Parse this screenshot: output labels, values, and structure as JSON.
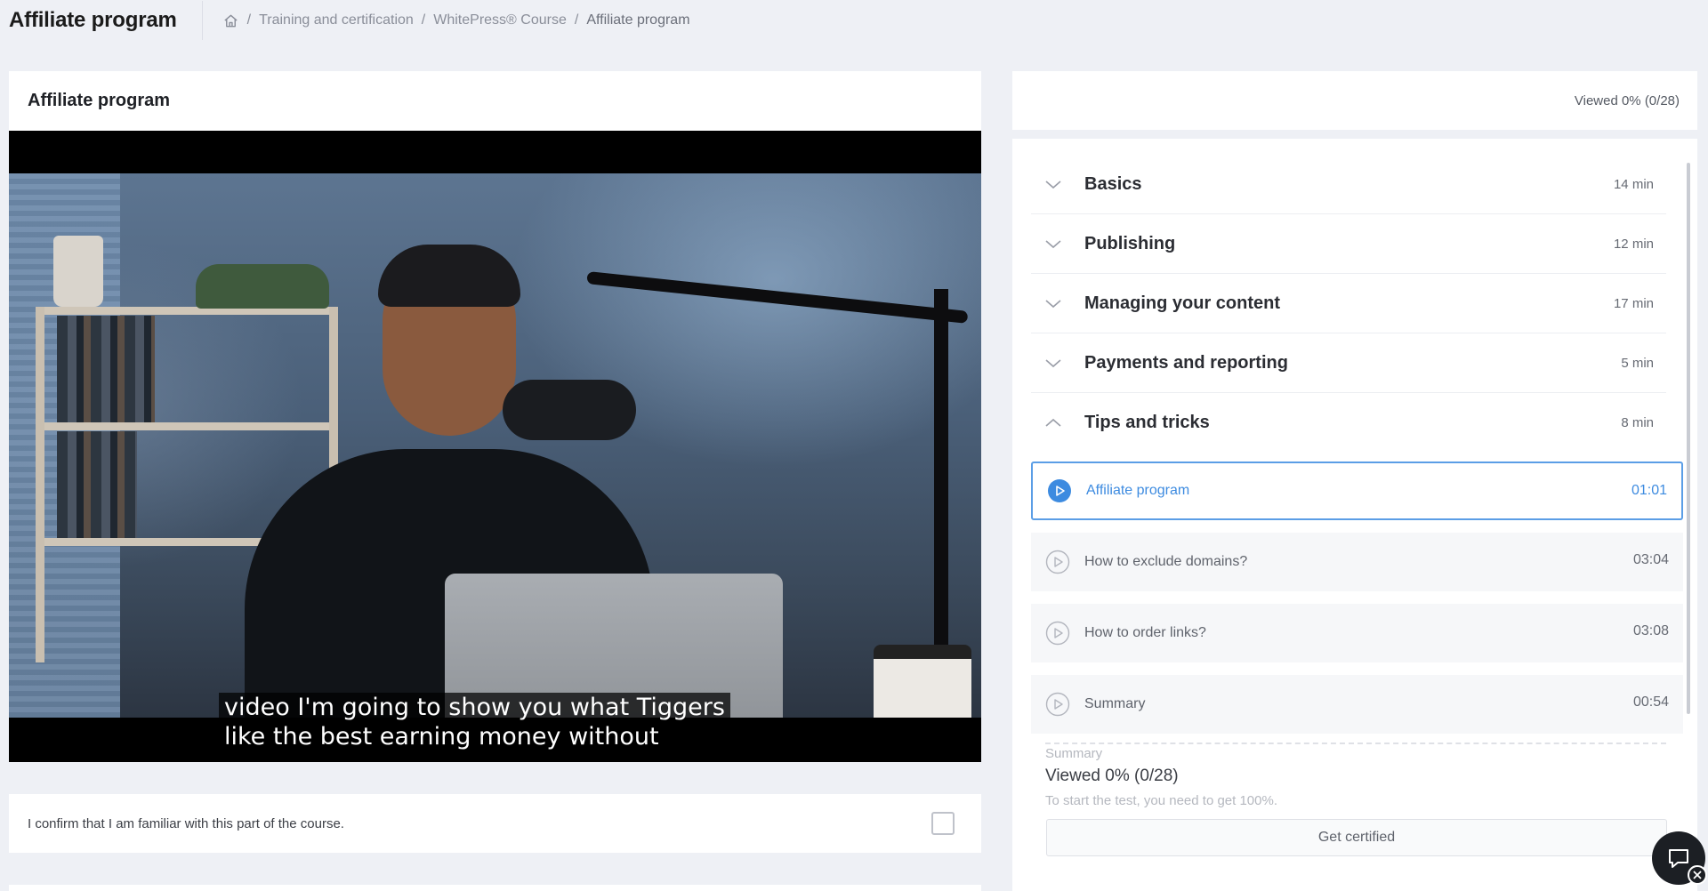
{
  "header": {
    "title": "Affiliate program",
    "breadcrumb": [
      "Training and certification",
      "WhitePress® Course",
      "Affiliate program"
    ]
  },
  "video": {
    "title": "Affiliate program",
    "subtitle_lines": [
      "video I'm going to show you what Tiggers",
      "like the best earning money without"
    ]
  },
  "confirm": {
    "text": "I confirm that I am familiar with this part of the course.",
    "checked": false
  },
  "progress": {
    "label": "Viewed 0% (0/28)"
  },
  "sections": [
    {
      "title": "Basics",
      "duration": "14 min",
      "expanded": false
    },
    {
      "title": "Publishing",
      "duration": "12 min",
      "expanded": false
    },
    {
      "title": "Managing your content",
      "duration": "17 min",
      "expanded": false
    },
    {
      "title": "Payments and reporting",
      "duration": "5 min",
      "expanded": false
    },
    {
      "title": "Tips and tricks",
      "duration": "8 min",
      "expanded": true
    }
  ],
  "lessons": [
    {
      "title": "Affiliate program",
      "time": "01:01",
      "active": true
    },
    {
      "title": "How to exclude domains?",
      "time": "03:04",
      "active": false
    },
    {
      "title": "How to order links?",
      "time": "03:08",
      "active": false
    },
    {
      "title": "Summary",
      "time": "00:54",
      "active": false
    }
  ],
  "summary": {
    "label": "Summary",
    "viewed": "Viewed 0% (0/28)",
    "hint": "To start the test, you need to get 100%.",
    "button_label": "Get certified"
  },
  "colors": {
    "accent": "#3d8be0",
    "background": "#eef0f5",
    "card": "#ffffff"
  },
  "icons": {
    "home": "home-icon",
    "section_collapsed": "chevron-down-icon",
    "section_expanded": "chevron-up-icon",
    "lesson": "play-circle-icon",
    "chat": "chat-icon"
  }
}
